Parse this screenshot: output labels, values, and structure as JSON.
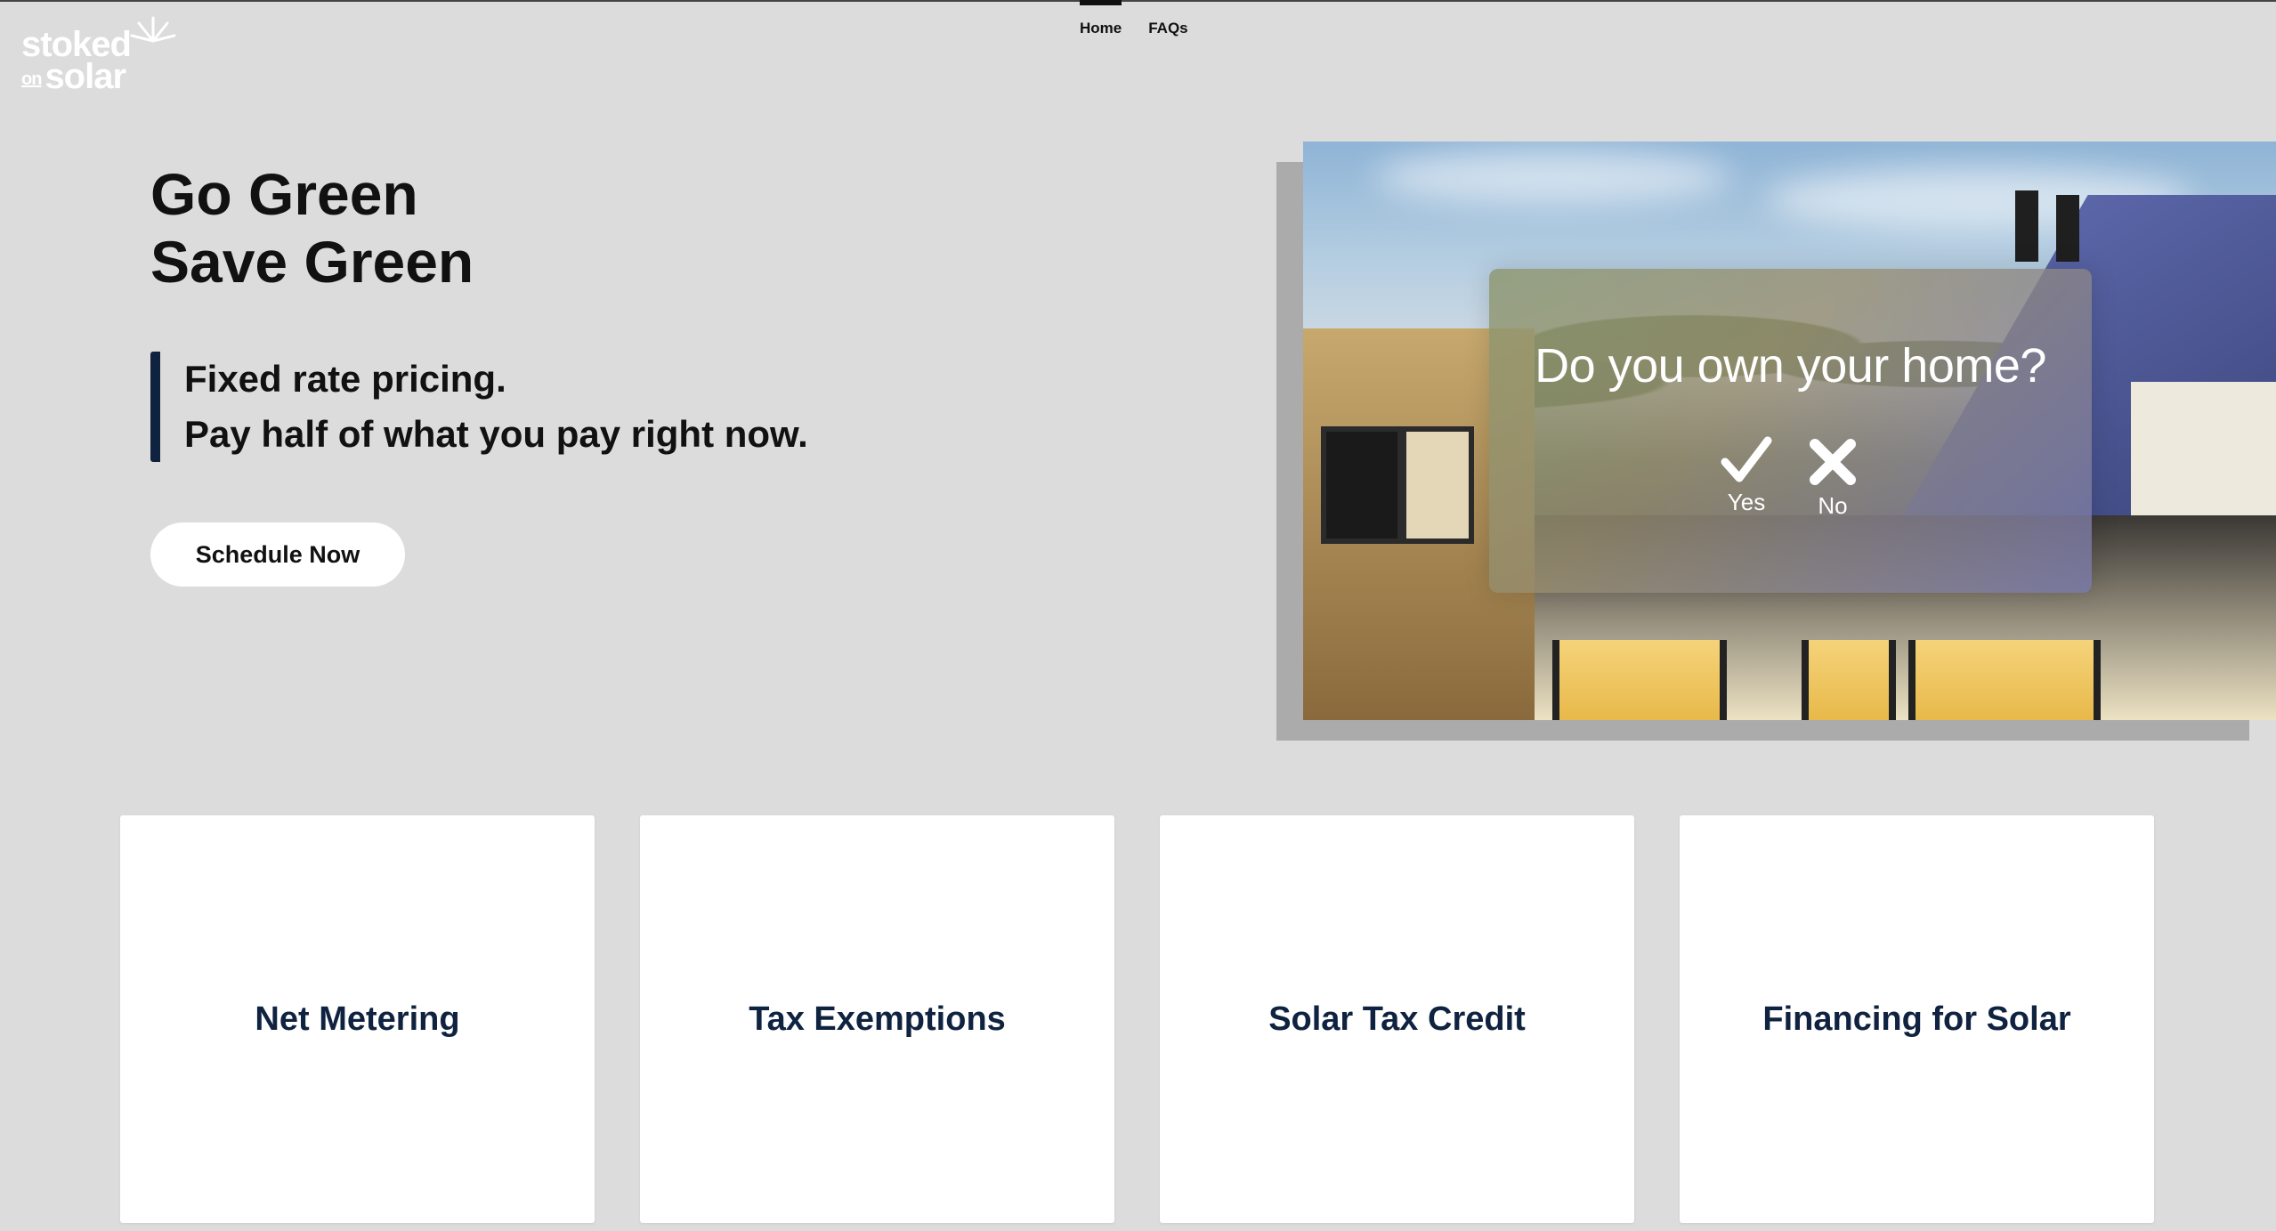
{
  "brand": {
    "line1": "stoked",
    "line2_prefix": "on",
    "line2": "solar"
  },
  "nav": {
    "home": "Home",
    "faqs": "FAQs"
  },
  "hero": {
    "title_line1": "Go Green",
    "title_line2": "Save Green",
    "tagline_line1": "Fixed rate pricing.",
    "tagline_line2": "Pay half of what you pay right now.",
    "cta": "Schedule Now"
  },
  "quiz": {
    "question": "Do you own your home?",
    "yes": "Yes",
    "no": "No"
  },
  "cards": [
    {
      "label": "Net Metering"
    },
    {
      "label": "Tax Exemptions"
    },
    {
      "label": "Solar Tax Credit"
    },
    {
      "label": "Financing for Solar"
    }
  ],
  "colors": {
    "background": "#dcdcdc",
    "navy": "#0f2340",
    "card": "#ffffff"
  }
}
